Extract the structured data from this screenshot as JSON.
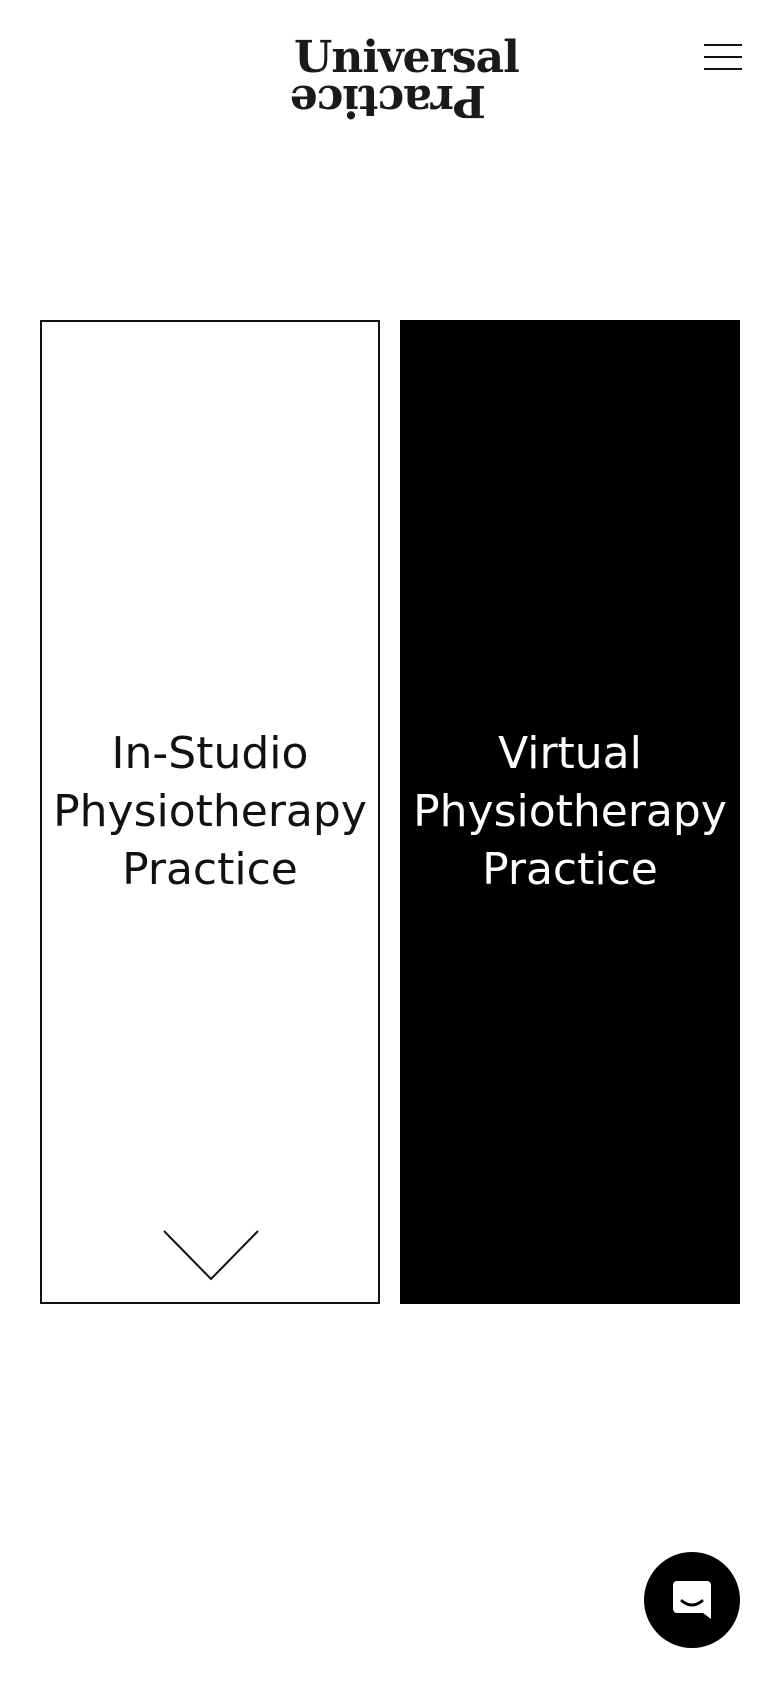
{
  "header": {
    "logo_line1": "Universal",
    "logo_line2": "Practice",
    "menu_icon": "hamburger-menu-icon"
  },
  "cards": [
    {
      "title": "In-Studio\nPhysiotherapy\nPractice",
      "style": "outlined",
      "icon": "chevron-down-icon"
    },
    {
      "title": "Virtual\nPhysiotherapy\nPractice",
      "style": "filled",
      "background": "#000000",
      "text_color": "#ffffff"
    }
  ],
  "chat": {
    "icon": "chat-icon"
  },
  "colors": {
    "background": "#ffffff",
    "foreground": "#111111",
    "accent": "#000000"
  }
}
